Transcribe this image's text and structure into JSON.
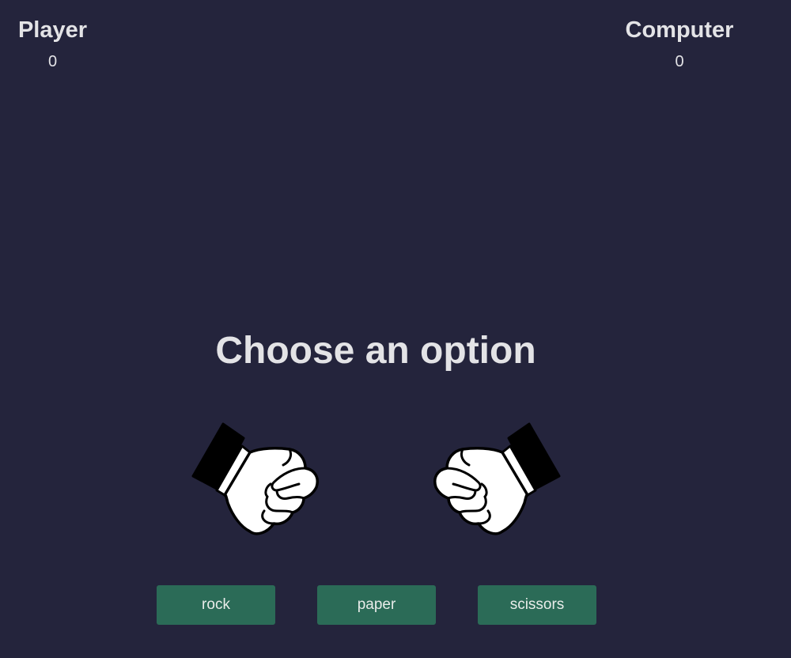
{
  "scoreboard": {
    "player": {
      "label": "Player",
      "score": "0"
    },
    "computer": {
      "label": "Computer",
      "score": "0"
    }
  },
  "prompt": "Choose an option",
  "hands": {
    "player": "rock-fist-icon",
    "computer": "rock-fist-icon"
  },
  "choices": {
    "rock": "rock",
    "paper": "paper",
    "scissors": "scissors"
  },
  "colors": {
    "background": "#24243c",
    "button": "#2b6b57",
    "text": "#e3e3e6"
  }
}
